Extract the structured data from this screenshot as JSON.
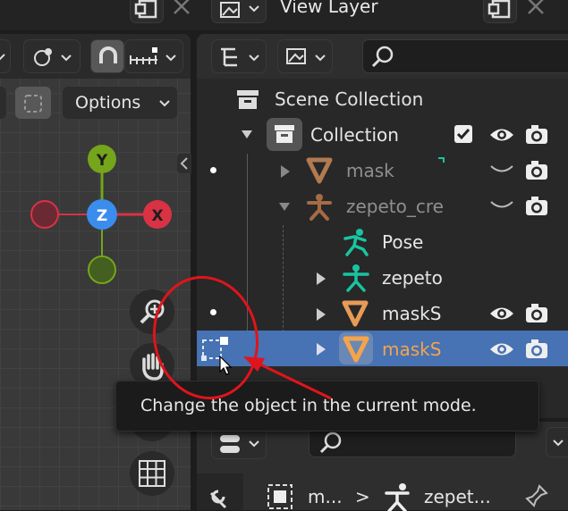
{
  "header": {
    "view_layer_label": "View Layer"
  },
  "viewport": {
    "options_label": "Options",
    "gizmo": {
      "y": "Y",
      "z": "Z",
      "x": "X"
    }
  },
  "outliner": {
    "scene_collection": "Scene Collection",
    "collection": "Collection",
    "rows": {
      "mask": "mask",
      "zepeto_cre": "zepeto_cre",
      "pose": "Pose",
      "zepeto": "zepeto",
      "maskS1": "maskS",
      "maskS2": "maskS"
    }
  },
  "tooltip": {
    "text": "Change the object in the current mode."
  },
  "properties": {
    "breadcrumb_mesh": "m...",
    "breadcrumb_separator": ">",
    "breadcrumb_armature": "zepet..."
  },
  "colors": {
    "accent_blue": "#4772b3",
    "active_orange": "#f5a44a",
    "annotation_red": "#e0141c",
    "axis_x": "#d93245",
    "axis_y": "#74a51b",
    "axis_z": "#3b8ded",
    "armature_green": "#19c4a0"
  }
}
